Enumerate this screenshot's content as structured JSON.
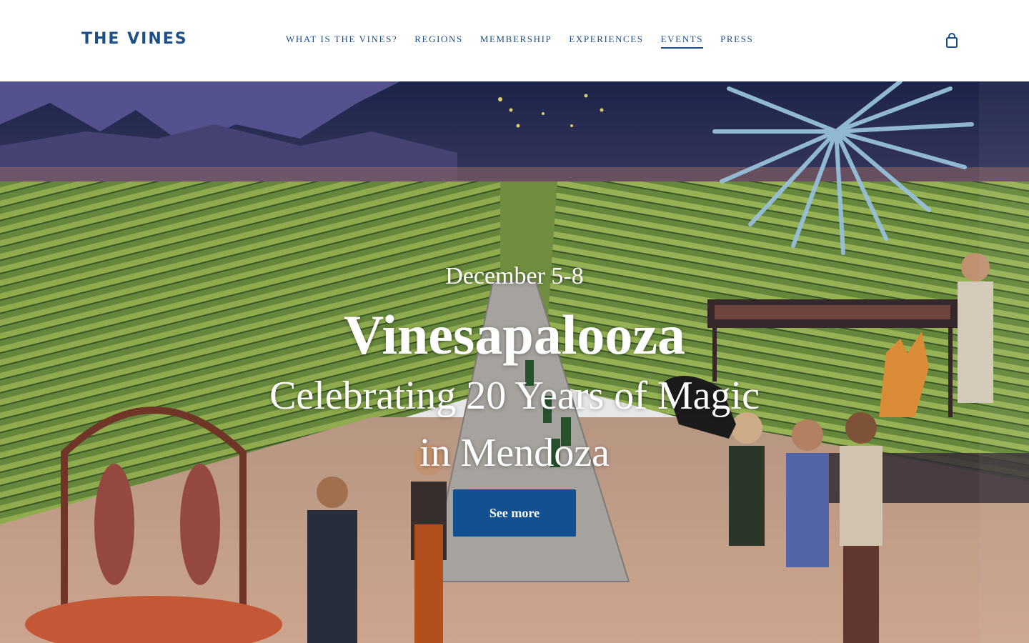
{
  "header": {
    "logo": "THE VINES",
    "nav": [
      {
        "label": "WHAT IS THE VINES?"
      },
      {
        "label": "REGIONS"
      },
      {
        "label": "MEMBERSHIP"
      },
      {
        "label": "EXPERIENCES"
      },
      {
        "label": "EVENTS",
        "active": true
      },
      {
        "label": "PRESS"
      }
    ],
    "cart_icon": "shopping-bag-icon"
  },
  "hero": {
    "date": "December 5-8",
    "title": "Vinesapalooza",
    "subtitle": "Celebrating 20 Years of Magic in Mendoza",
    "button_label": "See more",
    "image": "illustration of a vineyard feast at night with fireworks, grill, and people toasting"
  },
  "colors": {
    "brand": "#1b4f8a",
    "button": "#12508f"
  }
}
